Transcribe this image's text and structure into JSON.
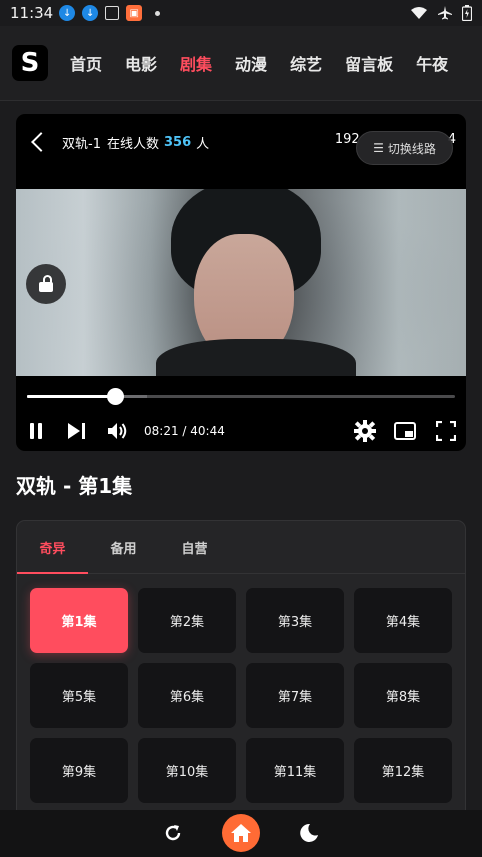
{
  "status_bar": {
    "time": "11:34",
    "icons": [
      "download-icon",
      "download-icon",
      "package-icon",
      "app-icon",
      "dot-icon",
      "wifi-icon",
      "airplane-icon",
      "battery-icon"
    ]
  },
  "nav": {
    "logo": "S",
    "items": [
      {
        "label": "首页",
        "active": false
      },
      {
        "label": "电影",
        "active": false
      },
      {
        "label": "剧集",
        "active": true
      },
      {
        "label": "动漫",
        "active": false
      },
      {
        "label": "综艺",
        "active": false
      },
      {
        "label": "留言板",
        "active": false
      },
      {
        "label": "午夜",
        "active": false
      }
    ],
    "active_color": "#ff4d5e"
  },
  "player": {
    "title": "双轨-1",
    "online_label": "在线人数",
    "online_count": "356",
    "online_unit": "人",
    "resolution_partial": "192",
    "resolution_tail": "4",
    "switch_line_label": "切换线路",
    "current_time": "08:21",
    "total_time": "40:44",
    "time_display": "08:21 / 40:44",
    "progress_fraction": 0.205,
    "buffered_fraction": 0.28,
    "count_color": "#4fc3f7"
  },
  "episode_title": "双轨 - 第1集",
  "sources": {
    "tabs": [
      {
        "label": "奇异",
        "active": true
      },
      {
        "label": "备用",
        "active": false
      },
      {
        "label": "自营",
        "active": false
      }
    ],
    "episodes": [
      {
        "label": "第1集",
        "active": true
      },
      {
        "label": "第2集",
        "active": false
      },
      {
        "label": "第3集",
        "active": false
      },
      {
        "label": "第4集",
        "active": false
      },
      {
        "label": "第5集",
        "active": false
      },
      {
        "label": "第6集",
        "active": false
      },
      {
        "label": "第7集",
        "active": false
      },
      {
        "label": "第8集",
        "active": false
      },
      {
        "label": "第9集",
        "active": false
      },
      {
        "label": "第10集",
        "active": false
      },
      {
        "label": "第11集",
        "active": false
      },
      {
        "label": "第12集",
        "active": false
      }
    ]
  },
  "bottom_bar": {
    "icons": [
      "refresh-icon",
      "home-icon",
      "moon-icon"
    ],
    "home_color": "#ff6b35"
  }
}
